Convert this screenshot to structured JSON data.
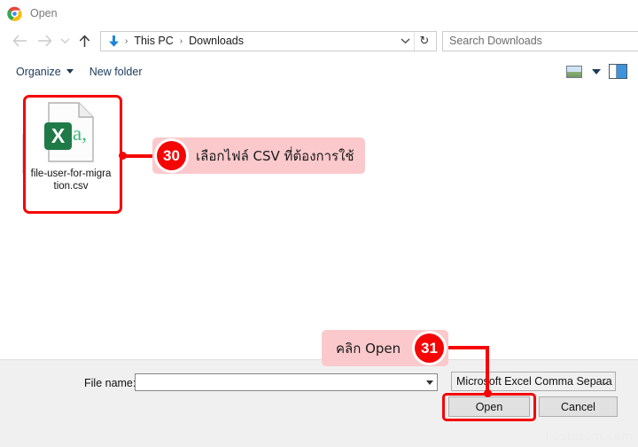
{
  "window": {
    "title": "Open",
    "app_icon": "chrome-logo-icon"
  },
  "navigation": {
    "back_icon": "back-arrow-icon",
    "forward_icon": "forward-arrow-icon",
    "history_icon": "recent-locations-chevron-icon",
    "up_icon": "up-arrow-icon",
    "breadcrumb": {
      "folder_icon": "downloads-arrow-icon",
      "items": [
        "This PC",
        "Downloads"
      ],
      "separator": "›",
      "dropdown_icon": "chevron-down-icon",
      "refresh_icon": "refresh-icon",
      "refresh_glyph": "↻"
    },
    "search": {
      "placeholder": "Search Downloads",
      "value": ""
    }
  },
  "toolbar": {
    "organize_label": "Organize",
    "new_folder_label": "New folder",
    "view_icon": "view-layout-icon",
    "view_caret_icon": "chevron-down-icon",
    "preview_pane_icon": "preview-pane-icon"
  },
  "file_list": {
    "items": [
      {
        "name": "file-user-for-migration.csv",
        "icon": "excel-csv-file-icon",
        "icon_badge_letter": "X",
        "icon_badge_suffix": "a,",
        "selected": true
      }
    ]
  },
  "footer": {
    "filename_label": "File name:",
    "filename_value": "",
    "filetype_value": "Microsoft Excel Comma Separa",
    "filetype_chevron": "⌄",
    "open_label": "Open",
    "cancel_label": "Cancel"
  },
  "annotations": [
    {
      "badge": "30",
      "text": "เลือกไฟล์ CSV ที่ต้องการใช้",
      "target": "file-item",
      "bg_color": "#fbc9cc",
      "badge_color": "#f50505"
    },
    {
      "badge": "31",
      "text": "คลิก Open",
      "target": "open-button",
      "bg_color": "#fbc9cc",
      "badge_color": "#f50505"
    }
  ],
  "watermark": "hostatom.com"
}
